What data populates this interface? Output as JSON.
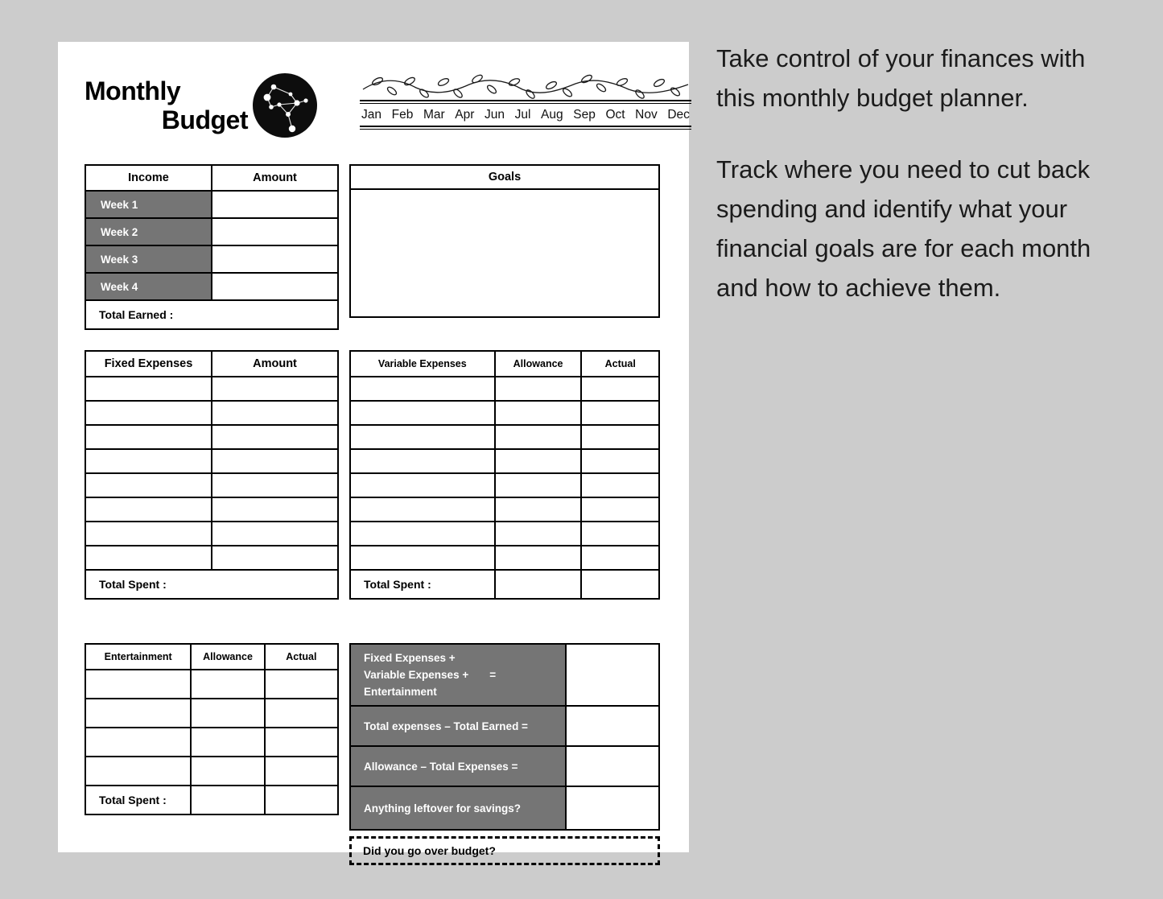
{
  "logo": {
    "line1": "Monthly",
    "line2": "Budget",
    "icon": "constellation-circle-icon"
  },
  "months": [
    "Jan",
    "Feb",
    "Mar",
    "Apr",
    "Jun",
    "Jul",
    "Aug",
    "Sep",
    "Oct",
    "Nov",
    "Dec"
  ],
  "decoration": {
    "vine": "vine-leaves-divider"
  },
  "income": {
    "headers": [
      "Income",
      "Amount"
    ],
    "rows": [
      "Week 1",
      "Week 2",
      "Week 3",
      "Week 4"
    ],
    "total_label": "Total Earned :"
  },
  "goals": {
    "header": "Goals"
  },
  "fixed_expenses": {
    "headers": [
      "Fixed Expenses",
      "Amount"
    ],
    "row_count": 8,
    "total_label": "Total Spent :"
  },
  "variable_expenses": {
    "headers": [
      "Variable Expenses",
      "Allowance",
      "Actual"
    ],
    "row_count": 8,
    "total_label": "Total Spent :"
  },
  "entertainment": {
    "headers": [
      "Entertainment",
      "Allowance",
      "Actual"
    ],
    "row_count": 4,
    "total_label": "Total Spent :"
  },
  "summary": {
    "rows": [
      {
        "line1": "Fixed Expenses +",
        "line2": "Variable Expenses +",
        "equals": "=",
        "line3": "Entertainment"
      },
      {
        "label": "Total expenses – Total Earned ="
      },
      {
        "label": "Allowance – Total Expenses ="
      },
      {
        "label": "Anything leftover for savings?"
      }
    ],
    "over_budget_label": "Did you go over budget?"
  },
  "marketing": {
    "paragraph1": "Take control of your finances with this monthly budget planner.",
    "paragraph2": "Track where you need to cut back spending and identify what your financial goals are for each month and how to achieve them."
  },
  "colors": {
    "background": "#cccccc",
    "paper": "#ffffff",
    "gray_fill": "#757575",
    "ink": "#000000"
  }
}
